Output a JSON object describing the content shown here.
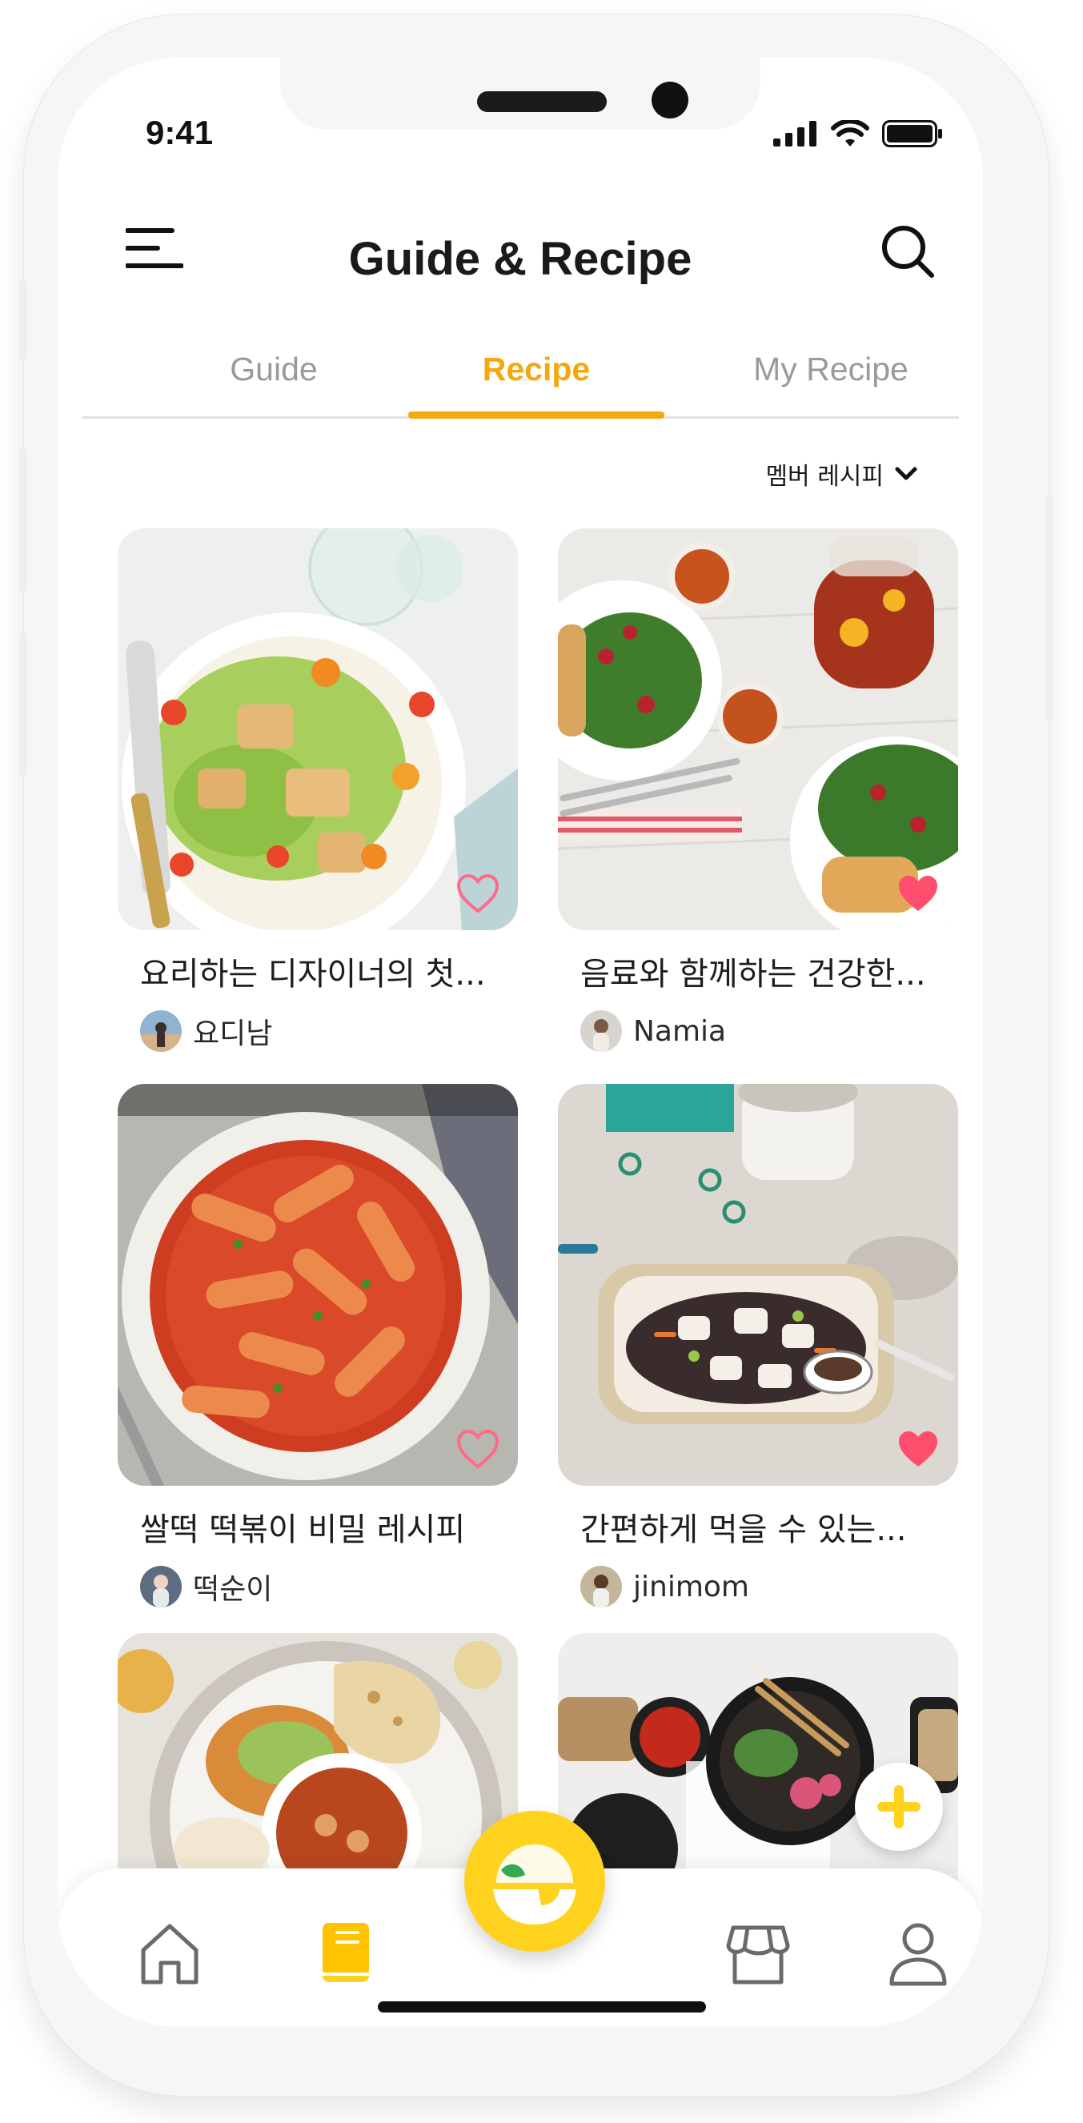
{
  "status": {
    "time": "9:41"
  },
  "header": {
    "title": "Guide & Recipe"
  },
  "tabs": [
    {
      "label": "Guide",
      "active": false
    },
    {
      "label": "Recipe",
      "active": true
    },
    {
      "label": "My Recipe",
      "active": false
    }
  ],
  "filter": {
    "label": "멤버 레시피"
  },
  "recipes": [
    {
      "title": "요리하는 디자이너의 첫...",
      "author": "요디남",
      "liked": false
    },
    {
      "title": "음료와 함께하는 건강한...",
      "author": "Namia",
      "liked": true
    },
    {
      "title": "쌀떡 떡볶이 비밀 레시피",
      "author": "떡순이",
      "liked": false
    },
    {
      "title": "간편하게 먹을 수 있는...",
      "author": "jinimom",
      "liked": true
    }
  ],
  "colors": {
    "accent": "#f5a70f",
    "fab": "#ffd21e",
    "heart": "#ff4d6d"
  },
  "nav_icons": [
    "home-icon",
    "book-icon",
    "bowl-logo-icon",
    "store-icon",
    "profile-icon"
  ]
}
